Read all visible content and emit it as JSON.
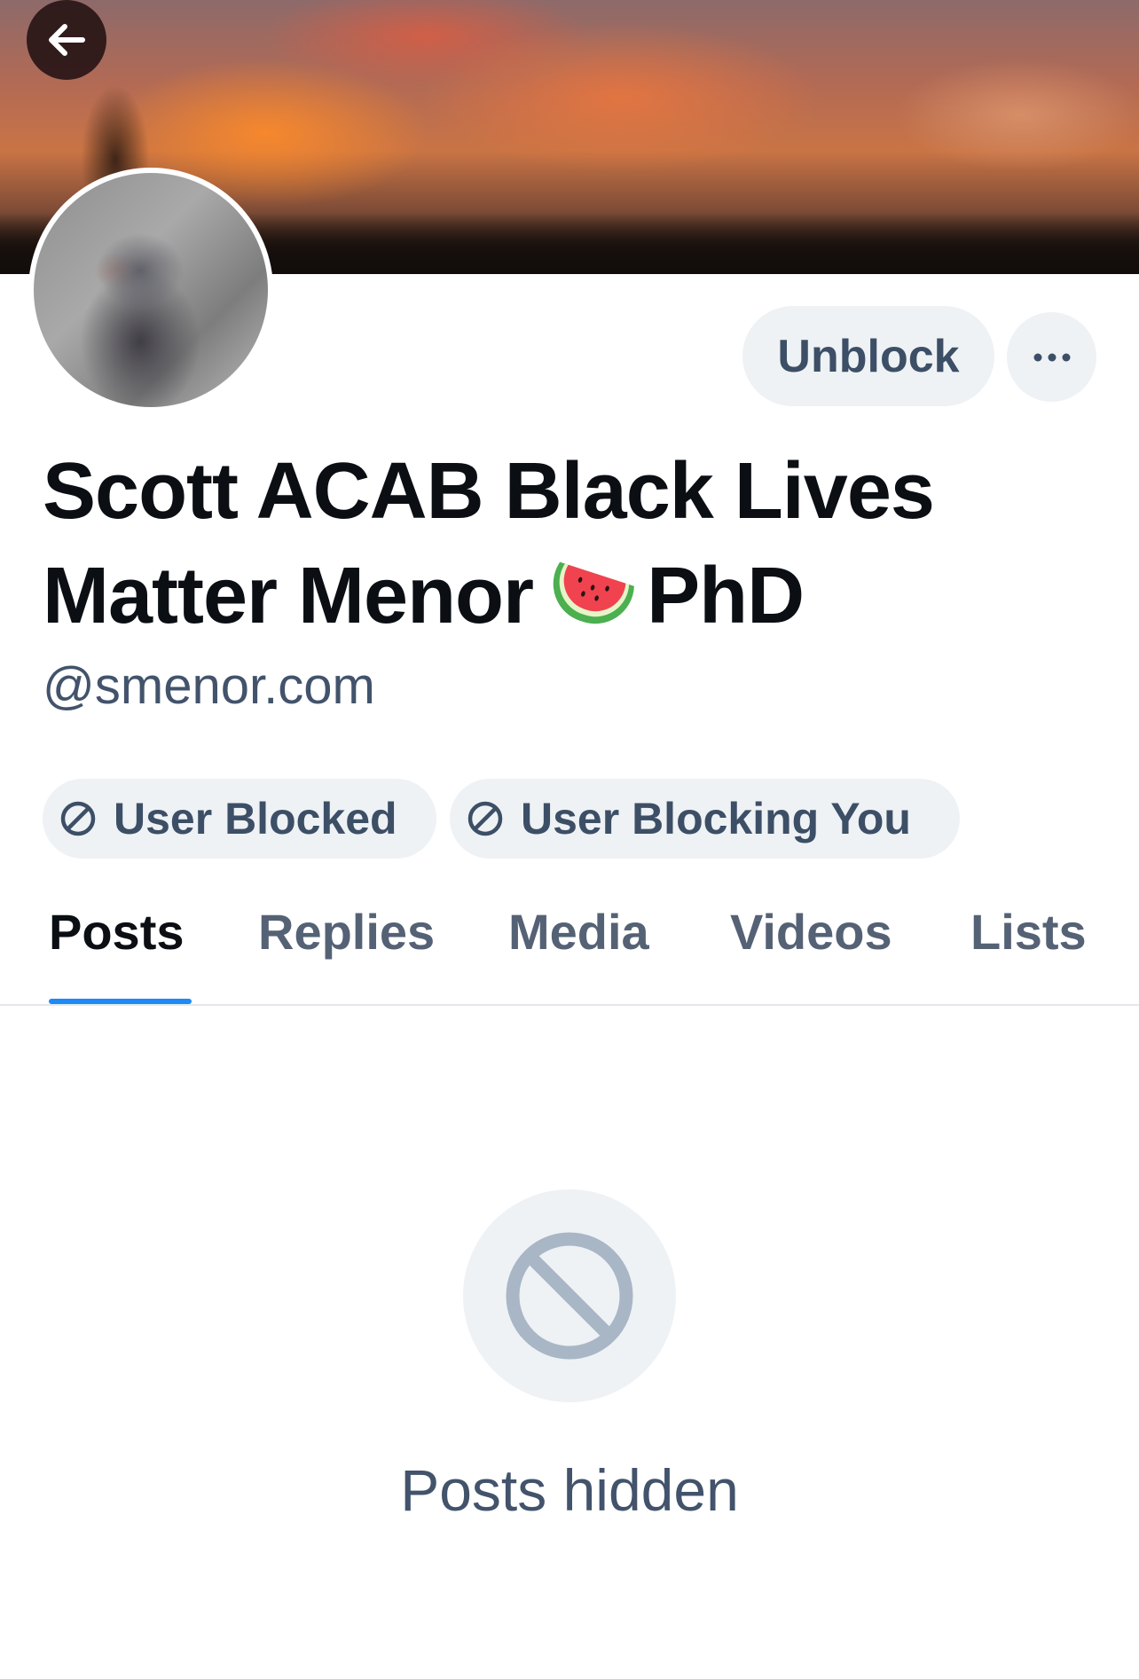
{
  "profile": {
    "display_name_line1": "Scott ACAB Black Lives",
    "display_name_line2a": "Matter Menor",
    "display_name_emoji": "watermelon-emoji",
    "display_name_line2b": "PhD",
    "handle": "@smenor.com"
  },
  "actions": {
    "unblock_label": "Unblock",
    "more_icon": "ellipsis-icon",
    "back_icon": "arrow-left-icon"
  },
  "badges": [
    {
      "label": "User Blocked",
      "icon": "blocked-icon"
    },
    {
      "label": "User Blocking You",
      "icon": "blocked-icon"
    }
  ],
  "tabs": [
    {
      "label": "Posts",
      "active": true
    },
    {
      "label": "Replies",
      "active": false
    },
    {
      "label": "Media",
      "active": false
    },
    {
      "label": "Videos",
      "active": false
    },
    {
      "label": "Lists",
      "active": false
    }
  ],
  "empty_state": {
    "icon": "blocked-icon",
    "text": "Posts hidden"
  },
  "colors": {
    "accent": "#1d8af5",
    "pill_background": "#eef2f5",
    "secondary_text": "#42536b",
    "primary_text": "#0b0f14"
  }
}
